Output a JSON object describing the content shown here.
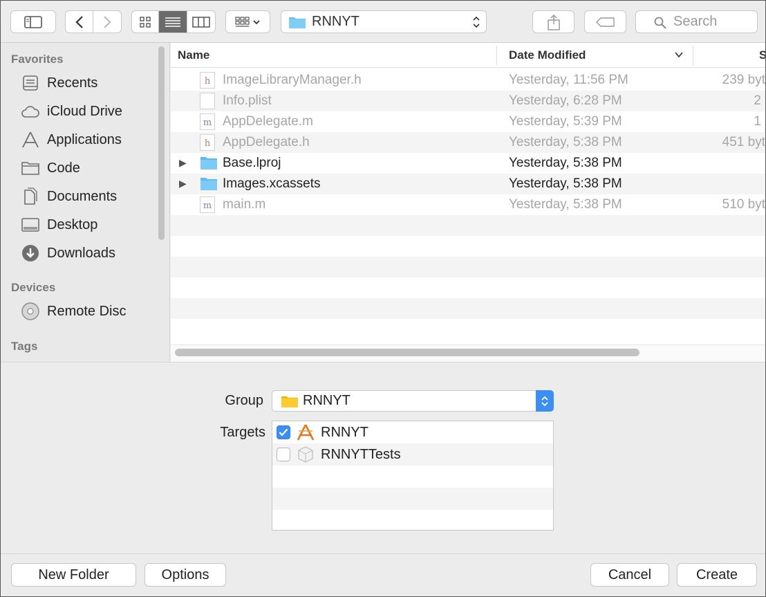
{
  "toolbar": {
    "path_title": "RNNYT",
    "search_placeholder": "Search"
  },
  "sidebar": {
    "favorites_header": "Favorites",
    "favorites": [
      {
        "label": "Recents",
        "icon": "recents-icon"
      },
      {
        "label": "iCloud Drive",
        "icon": "cloud-icon"
      },
      {
        "label": "Applications",
        "icon": "applications-icon"
      },
      {
        "label": "Code",
        "icon": "folder-icon"
      },
      {
        "label": "Documents",
        "icon": "documents-icon"
      },
      {
        "label": "Desktop",
        "icon": "desktop-icon"
      },
      {
        "label": "Downloads",
        "icon": "downloads-icon"
      }
    ],
    "devices_header": "Devices",
    "devices": [
      {
        "label": "Remote Disc",
        "icon": "disc-icon"
      }
    ],
    "tags_header": "Tags"
  },
  "file_list": {
    "columns": {
      "name": "Name",
      "date": "Date Modified",
      "size": "S"
    },
    "rows": [
      {
        "name": "ImageLibraryManager.h",
        "date": "Yesterday, 11:56 PM",
        "size": "239 byt",
        "kind": "h"
      },
      {
        "name": "Info.plist",
        "date": "Yesterday, 6:28 PM",
        "size": "2",
        "kind": "plist"
      },
      {
        "name": "AppDelegate.m",
        "date": "Yesterday, 5:39 PM",
        "size": "1",
        "kind": "m"
      },
      {
        "name": "AppDelegate.h",
        "date": "Yesterday, 5:38 PM",
        "size": "451 byt",
        "kind": "h"
      },
      {
        "name": "Base.lproj",
        "date": "Yesterday, 5:38 PM",
        "size": "",
        "kind": "folder"
      },
      {
        "name": "Images.xcassets",
        "date": "Yesterday, 5:38 PM",
        "size": "",
        "kind": "folder"
      },
      {
        "name": "main.m",
        "date": "Yesterday, 5:38 PM",
        "size": "510 byt",
        "kind": "m"
      }
    ]
  },
  "options": {
    "group_label": "Group",
    "group_value": "RNNYT",
    "targets_label": "Targets",
    "targets": [
      {
        "name": "RNNYT",
        "checked": true
      },
      {
        "name": "RNNYTTests",
        "checked": false
      }
    ]
  },
  "buttons": {
    "new_folder": "New Folder",
    "options": "Options",
    "cancel": "Cancel",
    "create": "Create"
  },
  "colors": {
    "accent": "#3c8ef3",
    "folder": "#6ec3f2",
    "group_folder": "#ffc92a"
  }
}
